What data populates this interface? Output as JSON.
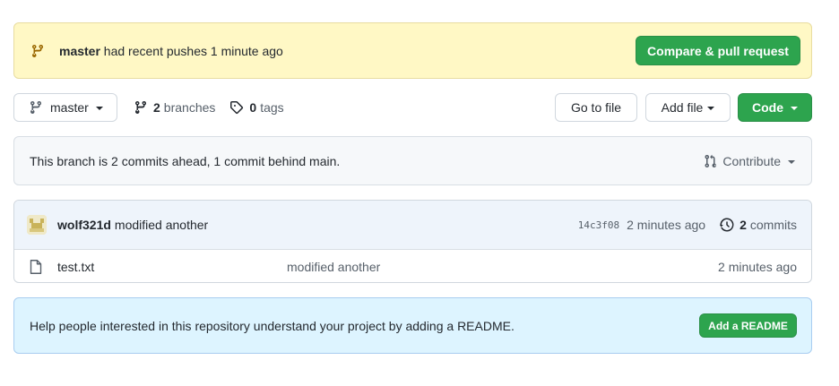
{
  "flash": {
    "branch": "master",
    "message": " had recent pushes 1 minute ago",
    "button": "Compare & pull request"
  },
  "toolbar": {
    "branch_selector": "master",
    "branches_count": "2",
    "branches_label": "branches",
    "tags_count": "0",
    "tags_label": "tags",
    "go_to_file": "Go to file",
    "add_file": "Add file",
    "code": "Code"
  },
  "branch_status": {
    "text": "This branch is 2 commits ahead, 1 commit behind main.",
    "contribute": "Contribute"
  },
  "latest_commit": {
    "author": "wolf321d",
    "message": "modified another",
    "sha": "14c3f08",
    "time": "2 minutes ago",
    "commits_count": "2",
    "commits_label": "commits"
  },
  "files": [
    {
      "name": "test.txt",
      "message": "modified another",
      "time": "2 minutes ago"
    }
  ],
  "readme_prompt": {
    "text": "Help people interested in this repository understand your project by adding a README.",
    "button": "Add a README"
  },
  "colors": {
    "primary_green": "#2da44e",
    "flash_bg": "#fff8c5",
    "readme_bg": "#ddf4ff",
    "muted_text": "#57606a"
  },
  "icons": [
    "git-branch-icon",
    "tag-icon",
    "git-pull-request-icon",
    "history-icon",
    "file-icon",
    "avatar"
  ]
}
